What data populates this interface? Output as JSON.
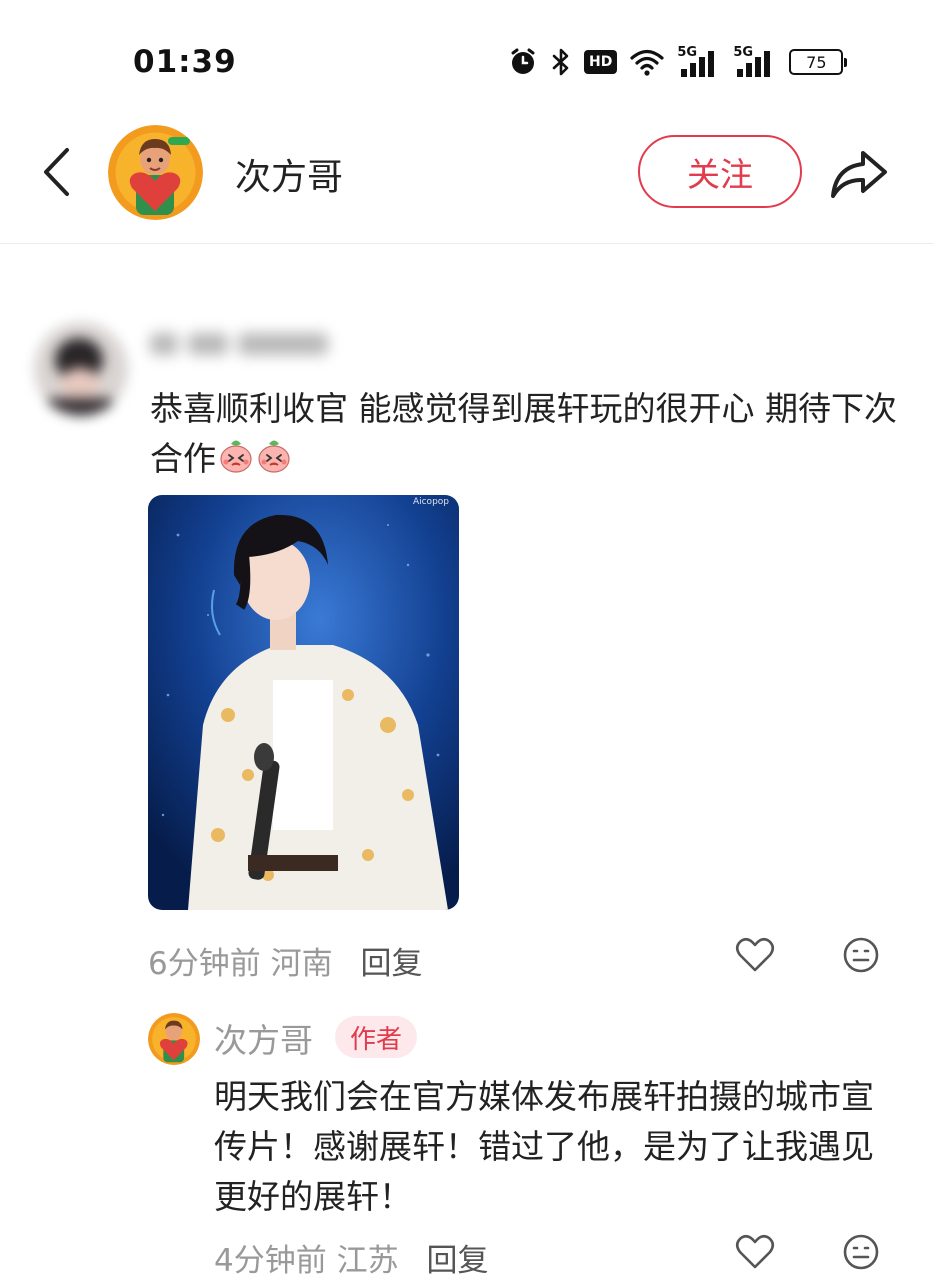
{
  "status_bar": {
    "time": "01:39",
    "hd_label": "HD",
    "signal_1_label": "5G",
    "signal_2_label": "5G",
    "battery_level": "75",
    "icons": [
      "alarm-icon",
      "bluetooth-icon",
      "hd-icon",
      "wifi-icon",
      "signal-icon",
      "signal-icon",
      "battery-icon"
    ]
  },
  "header": {
    "title": "次方哥",
    "follow_label": "关注",
    "back_icon": "chevron-left-icon",
    "share_icon": "share-icon"
  },
  "comment": {
    "text": "恭喜顺利收官 能感觉得到展轩玩的很开心 期待下次合作",
    "sticker_count": 2,
    "photo_watermark": "Aicopop",
    "time": "6分钟前",
    "location": "河南",
    "reply_label": "回复"
  },
  "reply": {
    "name": "次方哥",
    "author_tag": "作者",
    "text": "明天我们会在官方媒体发布展轩拍摄的城市宣传片！感谢展轩！错过了他，是为了让我遇见更好的展轩！",
    "time": "4分钟前",
    "location": "江苏",
    "reply_label": "回复"
  },
  "colors": {
    "accent": "#e23b4e",
    "meta_text": "#999999",
    "author_tag_bg": "#fde9ec"
  }
}
